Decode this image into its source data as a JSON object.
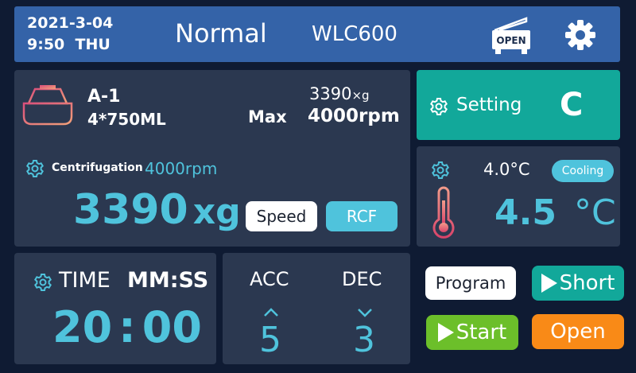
{
  "header": {
    "date": "2021-3-04",
    "time": "9:50",
    "weekday": "THU",
    "mode": "Normal",
    "model": "WLC600",
    "lid_label": "OPEN"
  },
  "rotor": {
    "name": "A-1",
    "capacity": "4*750ML",
    "max_label": "Max",
    "max_rcf": "3390",
    "rcf_unit": "×g",
    "max_speed": "4000rpm"
  },
  "centrifugation": {
    "label": "Centrifugation",
    "set_speed": "4000rpm",
    "current_value": "3390",
    "current_unit": "xg",
    "speed_button": "Speed",
    "rcf_button": "RCF"
  },
  "setting_panel": {
    "label": "Setting",
    "code": "C"
  },
  "temperature": {
    "set_value": "4.0°C",
    "status": "Cooling",
    "current_value": "4.5",
    "unit": "°C"
  },
  "time_panel": {
    "label": "TIME",
    "format": "MM:SS",
    "minutes": "20",
    "separator": ":",
    "seconds": "00"
  },
  "acc_dec": {
    "acc_label": "ACC",
    "acc_value": "5",
    "dec_label": "DEC",
    "dec_value": "3"
  },
  "buttons": {
    "program": "Program",
    "short": "Short",
    "start": "Start",
    "open": "Open"
  },
  "colors": {
    "accent_teal": "#4fc3dc",
    "setting_green": "#12a89a",
    "start_green": "#6cbf2a",
    "open_orange": "#f98a17",
    "header_blue": "#3463a8"
  }
}
